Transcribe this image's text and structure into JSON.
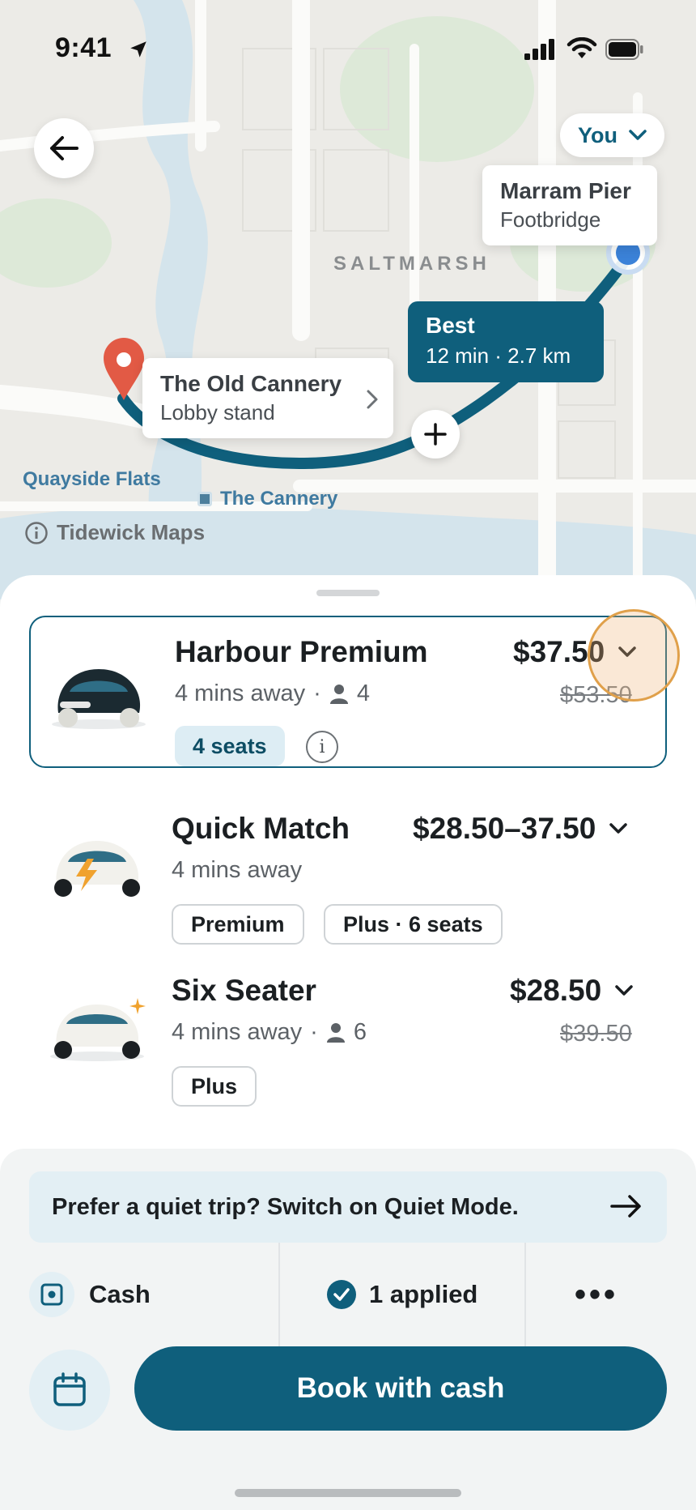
{
  "status_bar": {
    "time": "9:41"
  },
  "map": {
    "you_chip": "You",
    "destination": {
      "name": "Marram Pier",
      "detail": "Footbridge"
    },
    "origin": {
      "name": "The Old Cannery",
      "detail": "Lobby stand"
    },
    "route_best": {
      "label": "Best",
      "detail": "12 min · 2.7 km"
    },
    "district_label": "SALTMARSH",
    "place_labels": {
      "quayside": "Quayside Flats",
      "cannery_stop": "The Cannery"
    },
    "attribution": "Tidewick Maps"
  },
  "rides": [
    {
      "name": "Harbour Premium",
      "eta": "4 mins away",
      "passengers": "4",
      "price": "$37.50",
      "old_price": "$53.50",
      "tags": [
        "4 seats"
      ],
      "selected": true
    },
    {
      "name": "Quick Match",
      "eta": "4 mins away",
      "price": "$28.50–37.50",
      "tags": [
        "Premium",
        "Plus · 6 seats"
      ]
    },
    {
      "name": "Six Seater",
      "eta": "4 mins away",
      "passengers": "6",
      "price": "$28.50",
      "old_price": "$39.50",
      "tags": [
        "Plus"
      ]
    }
  ],
  "separator": "·",
  "promo_banner": "Prefer a quiet trip? Switch on Quiet Mode.",
  "payment": {
    "method": "Cash",
    "promo": "1 applied",
    "more": "•••"
  },
  "book_button": "Book with cash",
  "colors": {
    "brand": "#0f5f7c",
    "route": "#0f5f7c",
    "origin_pin": "#e25a45",
    "you_dot": "#3b82d8",
    "highlight": "#e0a04a"
  }
}
